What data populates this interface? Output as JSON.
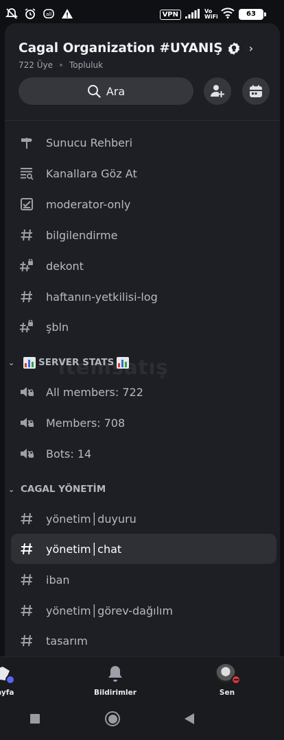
{
  "status": {
    "vpn": "VPN",
    "vowifi_top": "Vo",
    "vowifi_bottom": "WiFi",
    "battery": "63"
  },
  "server": {
    "name": "Cagal Organization #UYANIŞ",
    "members": "722 Üye",
    "type": "Topluluk"
  },
  "search": {
    "label": "Ara"
  },
  "channels_top": [
    {
      "label": "Sunucu Rehberi",
      "icon": "signpost-icon"
    },
    {
      "label": "Kanallara Göz At",
      "icon": "browse-channels-icon"
    },
    {
      "label": "moderator-only",
      "icon": "checklist-icon"
    },
    {
      "label": "bilgilendirme",
      "icon": "hash-icon"
    },
    {
      "label": "dekont",
      "icon": "hash-locked-icon"
    },
    {
      "label": "haftanın-yetkilisi-log",
      "icon": "hash-icon"
    },
    {
      "label": "şbln",
      "icon": "hash-locked-icon"
    }
  ],
  "category_stats": {
    "label": "SERVER STATS",
    "emoji": "bar-chart-emoji"
  },
  "channels_stats": [
    {
      "label": "All members: 722",
      "icon": "voice-locked-icon"
    },
    {
      "label": "Members: 708",
      "icon": "voice-locked-icon"
    },
    {
      "label": "Bots: 14",
      "icon": "voice-locked-icon"
    }
  ],
  "category_admin": {
    "label": "CAGAL YÖNETİM"
  },
  "channels_admin": [
    {
      "label": "yönetim│duyuru",
      "icon": "hash-icon"
    },
    {
      "label": "yönetim│chat",
      "icon": "hash-icon",
      "active": true
    },
    {
      "label": "iban",
      "icon": "hash-icon"
    },
    {
      "label": "yönetim│görev-dağılım",
      "icon": "hash-icon"
    },
    {
      "label": "tasarım",
      "icon": "hash-icon"
    }
  ],
  "watermark": "itemsatış",
  "bottom_nav": {
    "home": "Sayfa",
    "notifications": "Bildirimler",
    "profile": "Sen"
  },
  "colors": {
    "background": "#1e1f24",
    "active_row": "#2e3036",
    "online_dot": "#5865f2",
    "dnd_dot": "#da373c"
  }
}
